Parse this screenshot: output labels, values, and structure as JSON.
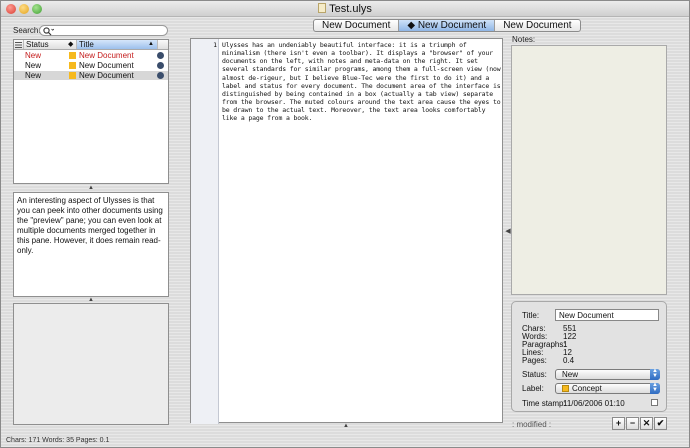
{
  "window": {
    "title": "Test.ulys"
  },
  "tabs": [
    "New Document",
    "◆ New Document",
    "New Document"
  ],
  "search": {
    "label": "Search:",
    "value": ""
  },
  "list": {
    "columns": [
      "Status",
      "Title"
    ],
    "rows": [
      {
        "status": "New",
        "title": "New Document",
        "color": "#c41b1b"
      },
      {
        "status": "New",
        "title": "New Document",
        "color": "#111111"
      },
      {
        "status": "New",
        "title": "New Document",
        "color": "#111111"
      }
    ]
  },
  "preview": {
    "text": "An interesting aspect of Ulysses is that you can peek into other documents using the \"preview\" pane; you can even look at multiple documents merged together in this pane. However, it does remain read-only."
  },
  "editor": {
    "line_number": "1",
    "text": "Ulysses has an undeniably beautiful interface: it is a triumph of minimalism (there isn't even a toolbar). It displays a \"browser\" of your documents on the left, with notes and meta-data on the right. It set several standards for similar programs, among them a full-screen view (now almost de-rigeur, but I believe Blue-Tec were the first to do it) and a label and status for every document. The document area of the interface is distinguished by being contained in a box (actually a tab view) separate from the browser. The muted colours around the text area cause the eyes to be drawn to the actual text. Moreover, the text area looks comfortably like a page from a book."
  },
  "notes": {
    "label": "Notes:"
  },
  "meta": {
    "title_label": "Title:",
    "title_value": "New Document",
    "chars_label": "Chars:",
    "chars": "551",
    "words_label": "Words:",
    "words": "122",
    "paragraphs_label": "Paragraphs:",
    "paragraphs": "1",
    "lines_label": "Lines:",
    "lines": "12",
    "pages_label": "Pages:",
    "pages": "0.4",
    "status_label": "Status:",
    "status_value": "New",
    "label_label": "Label:",
    "label_value": "Concept",
    "timestamp_label": "Time stamp:",
    "timestamp": "11/06/2006 01:10"
  },
  "modified": ": modified :",
  "buttons": [
    "+",
    "−",
    "✕",
    "✔"
  ],
  "footer": "Chars: 171   Words: 35   Pages: 0.1",
  "colors": {
    "accent": "#6f9fdc",
    "label_concept": "#f6b91e",
    "close": "#e0473e",
    "minimize": "#f3b233",
    "zoom": "#5dbb4a"
  }
}
